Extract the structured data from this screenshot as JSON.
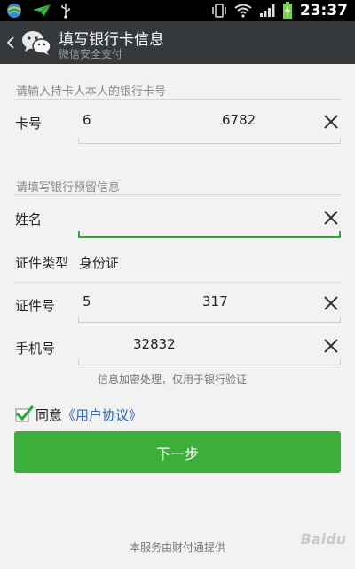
{
  "status_bar": {
    "time": "23:37",
    "icons": [
      "browser-globe-icon",
      "paper-plane-icon",
      "usb-icon",
      "vibrate-icon",
      "wifi-icon",
      "signal-icon",
      "battery-charging-icon"
    ]
  },
  "header": {
    "title": "填写银行卡信息",
    "subtitle": "微信安全支付",
    "icons": [
      "chevron-left-icon",
      "wechat-logo-icon"
    ]
  },
  "card_section": {
    "label": "请输入持卡人本人的银行卡号",
    "card_number": {
      "label": "卡号",
      "value_start": "6",
      "value_end": "6782"
    }
  },
  "bank_section": {
    "label": "请填写银行预留信息",
    "name": {
      "label": "姓名",
      "value": ""
    },
    "id_type": {
      "label": "证件类型",
      "value": "身份证"
    },
    "id_number": {
      "label": "证件号",
      "value_start": "5",
      "value_end": "317"
    },
    "phone": {
      "label": "手机号",
      "value_end": "32832"
    }
  },
  "hint": "信息加密处理，仅用于银行验证",
  "agreement": {
    "checked": true,
    "prefix": "同意",
    "link": "《用户协议》"
  },
  "next_button": "下一步",
  "footer": "本服务由财付通提供",
  "watermark": "Baidu",
  "colors": {
    "accent_green": "#3cae3a",
    "link_blue": "#2e66b8",
    "header_bg": "#36393c"
  }
}
